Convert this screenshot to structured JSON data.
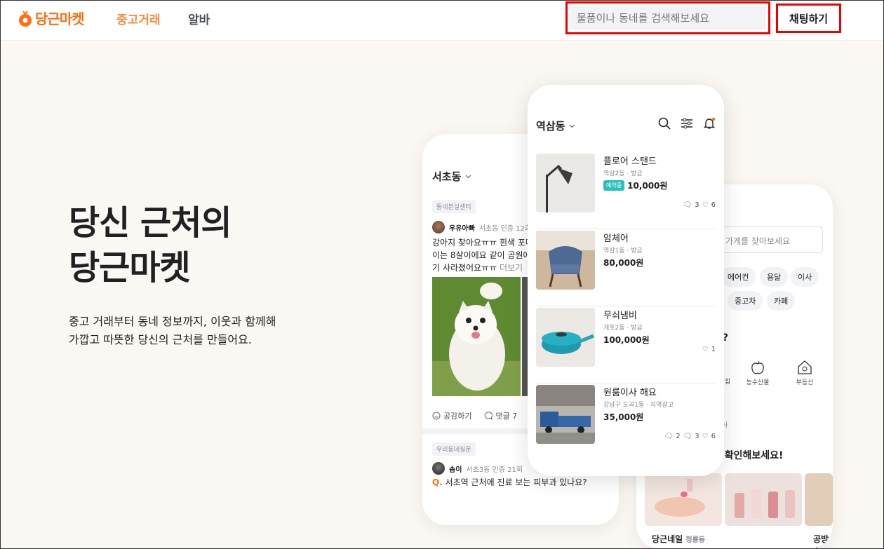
{
  "brand": {
    "name": "당근마켓",
    "color": "#ff6f0f"
  },
  "nav": {
    "used": "중고거래",
    "jobs": "알바"
  },
  "search": {
    "placeholder": "물품이나 동네를 검색해보세요"
  },
  "chat_button": "채팅하기",
  "hero": {
    "title_line1": "당신 근처의",
    "title_line2": "당근마켓",
    "sub_line1": "중고 거래부터 동네 정보까지, 이웃과 함께해",
    "sub_line2": "가깝고 따뜻한 당신의 근처를 만들어요."
  },
  "left_phone": {
    "location": "서초동",
    "post1": {
      "tag": "동네분실센터",
      "user": "우유아빠",
      "meta": "서초동 인증 12회",
      "line1": "강아지 찾아요ㅠㅠ 흰색 포메",
      "line2": "이는 8살이에요 같이 공원에",
      "line3": "기 사라졌어요ㅠㅠ",
      "more": "더보기"
    },
    "actions": {
      "like": "공감하기",
      "comments": "댓글 7"
    },
    "post2": {
      "tag": "우리동네질문",
      "user": "솜이",
      "meta": "서초3동 인증 21회",
      "q": "Q.",
      "text": "서초역 근처에 진료 보는 피부과 있나요?"
    }
  },
  "mid_phone": {
    "location": "역삼동",
    "items": [
      {
        "title": "플로어 스탠드",
        "meta": "역삼2동 · 방금",
        "badge": "예약중",
        "price": "10,000원",
        "chat": "3",
        "like": "6"
      },
      {
        "title": "암체어",
        "meta": "역삼1동 · 방금",
        "price": "80,000원"
      },
      {
        "title": "무쇠냄비",
        "meta": "개포2동 · 방금",
        "price": "100,000원",
        "like": "1"
      },
      {
        "title": "원룸이사 해요",
        "meta": "강남구 도곡1동 · 지역광고",
        "price": "35,000원",
        "a": "2",
        "chat": "3",
        "like": "6"
      }
    ]
  },
  "right_phone": {
    "search": "가게를 찾아보세요",
    "pills": [
      "에어컨",
      "용달",
      "이사",
      "중고차",
      "카페"
    ],
    "q": "요?",
    "cats": [
      "집",
      "농수산물",
      "부동산"
    ],
    "small": "사",
    "headline": "를 확인해보세요!",
    "shop1": "당근네일",
    "shop1_loc": "청룡동",
    "shop2": "공방순"
  }
}
